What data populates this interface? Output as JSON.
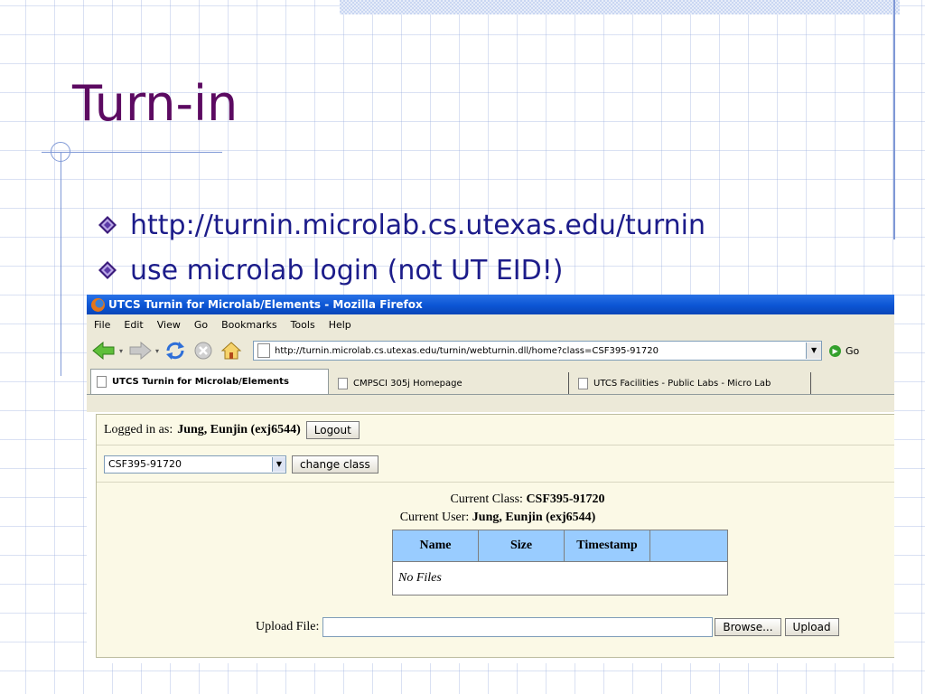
{
  "slide": {
    "title": "Turn-in",
    "bullets": [
      "http://turnin.microlab.cs.utexas.edu/turnin",
      "use microlab login (not UT EID!)"
    ]
  },
  "browser": {
    "window_title": "UTCS Turnin for Microlab/Elements - Mozilla Firefox",
    "menu": [
      "File",
      "Edit",
      "View",
      "Go",
      "Bookmarks",
      "Tools",
      "Help"
    ],
    "address": "http://turnin.microlab.cs.utexas.edu/turnin/webturnin.dll/home?class=CSF395-91720",
    "go_label": "Go",
    "tabs": [
      "UTCS Turnin for Microlab/Elements",
      "CMPSCI 305j Homepage",
      "UTCS Facilities - Public Labs - Micro Lab"
    ]
  },
  "page": {
    "logged_in_label": "Logged in as:",
    "user": "Jung, Eunjin (exj6544)",
    "logout_label": "Logout",
    "class_select_value": "CSF395-91720",
    "change_class_label": "change class",
    "current_class_label": "Current Class:",
    "current_class": "CSF395-91720",
    "current_user_label": "Current User:",
    "current_user": "Jung, Eunjin (exj6544)",
    "table": {
      "headers": [
        "Name",
        "Size",
        "Timestamp",
        ""
      ],
      "empty_text": "No Files"
    },
    "upload_label": "Upload File:",
    "browse_label": "Browse...",
    "upload_button": "Upload"
  },
  "colors": {
    "title": "#5c0a61",
    "bullet_text": "#1c1c8a",
    "table_header": "#99ccff",
    "titlebar": "#0b55d4"
  }
}
